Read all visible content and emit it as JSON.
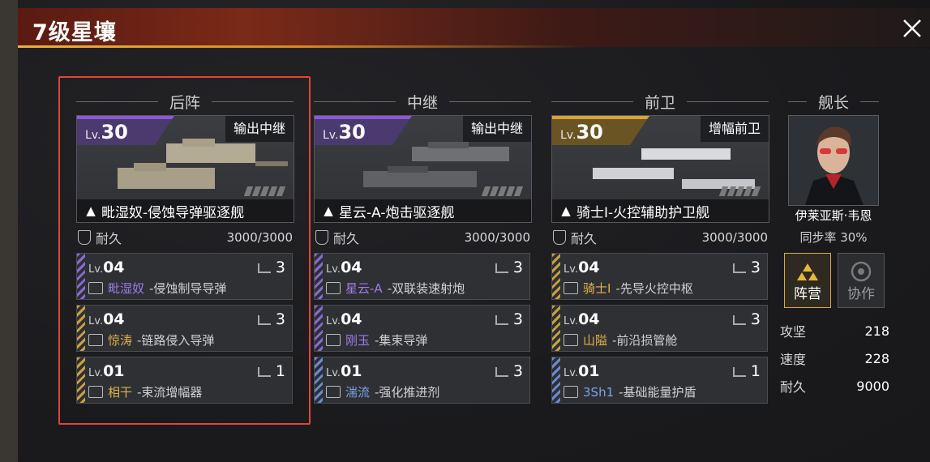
{
  "title": "7级星壤",
  "columns": [
    {
      "header": "后阵",
      "ship": {
        "level_prefix": "Lv.",
        "level": "30",
        "role": "输出中继",
        "rank": "▲",
        "name": "毗湿奴-侵蚀导弹驱逐舰",
        "accent": "#8a5ad6",
        "durability_label": "耐久",
        "durability": "3000/3000"
      },
      "slots": [
        {
          "level_prefix": "Lv.",
          "level": "04",
          "count": "3",
          "prefix": "毗湿奴",
          "suffix": "-侵蚀制导导弹",
          "prefix_color": "#9f7be8",
          "stripe": "#8a6ad0"
        },
        {
          "level_prefix": "Lv.",
          "level": "04",
          "count": "3",
          "prefix": "惊涛",
          "suffix": "-链路侵入导弹",
          "prefix_color": "#e0b24a",
          "stripe": "#c8a040"
        },
        {
          "level_prefix": "Lv.",
          "level": "01",
          "count": "1",
          "prefix": "相干",
          "suffix": "-束流增幅器",
          "prefix_color": "#e0b24a",
          "stripe": "#c8a040"
        }
      ]
    },
    {
      "header": "中继",
      "ship": {
        "level_prefix": "Lv.",
        "level": "30",
        "role": "输出中继",
        "rank": "▲",
        "name": "星云-A-炮击驱逐舰",
        "accent": "#8a5ad6",
        "durability_label": "耐久",
        "durability": "3000/3000"
      },
      "slots": [
        {
          "level_prefix": "Lv.",
          "level": "04",
          "count": "3",
          "prefix": "星云-A",
          "suffix": "-双联装速射炮",
          "prefix_color": "#9f7be8",
          "stripe": "#8a6ad0"
        },
        {
          "level_prefix": "Lv.",
          "level": "04",
          "count": "3",
          "prefix": "刚玉",
          "suffix": "-集束导弹",
          "prefix_color": "#9f7be8",
          "stripe": "#8a6ad0"
        },
        {
          "level_prefix": "Lv.",
          "level": "01",
          "count": "3",
          "prefix": "湍流",
          "suffix": "-强化推进剂",
          "prefix_color": "#7da3e8",
          "stripe": "#6a8ad0"
        }
      ]
    },
    {
      "header": "前卫",
      "ship": {
        "level_prefix": "Lv.",
        "level": "30",
        "role": "增幅前卫",
        "rank": "▲",
        "name": "骑士I-火控辅助护卫舰",
        "accent": "#d4a43a",
        "durability_label": "耐久",
        "durability": "3000/3000"
      },
      "slots": [
        {
          "level_prefix": "Lv.",
          "level": "04",
          "count": "3",
          "prefix": "骑士I",
          "suffix": "-先导火控中枢",
          "prefix_color": "#e0b24a",
          "stripe": "#c8a040"
        },
        {
          "level_prefix": "Lv.",
          "level": "04",
          "count": "3",
          "prefix": "山隘",
          "suffix": "-前沿损管舱",
          "prefix_color": "#e0b24a",
          "stripe": "#c8a040"
        },
        {
          "level_prefix": "Lv.",
          "level": "01",
          "count": "1",
          "prefix": "3Sh1",
          "suffix": "-基础能量护盾",
          "prefix_color": "#7da3e8",
          "stripe": "#6a8ad0"
        }
      ]
    }
  ],
  "captain": {
    "header": "舰长",
    "name": "伊莱亚斯·韦恩",
    "sync_text": "同步率 30%",
    "camp_label": "阵营",
    "coop_label": "协作",
    "stats": [
      {
        "label": "攻坚",
        "value": "218"
      },
      {
        "label": "速度",
        "value": "228"
      },
      {
        "label": "耐久",
        "value": "9000"
      }
    ]
  }
}
